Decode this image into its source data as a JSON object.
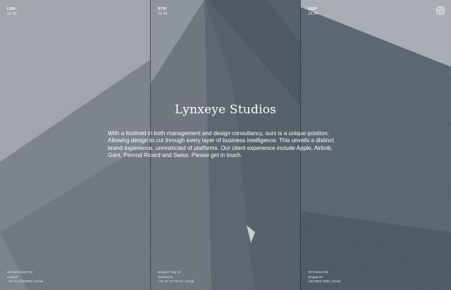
{
  "brand": {
    "title": "Lynxeye Studios"
  },
  "intro": {
    "text": "With a foothold in both management and design consultancy, ours is a unique position. Allowing design to cut through every layer of business intelligence. This unveils a distinct brand experience, unrestricted of platforms. Our client experience include Apple, Airbnb, Gant, Pernod Ricard and Swiss. Please get in touch."
  },
  "studios": [
    {
      "code": "LDN",
      "time": "10.34",
      "street": "20 Dorchester Rd",
      "city": "London",
      "phone": "+44 75 14834853",
      "email_label": "Email"
    },
    {
      "code": "STH",
      "time": "11.34",
      "street": "Bergdal Torg 16",
      "city": "Stockholm",
      "phone": "+46 75 747 80 71",
      "email_label": "Email"
    },
    {
      "code": "SGP",
      "time": "18.34",
      "street": "78 Duxton Rd",
      "city": "Singapore",
      "phone": "+65 8593 4086",
      "email_label": "Email"
    }
  ],
  "social": {
    "icon": "instagram-icon"
  },
  "colors": {
    "background": "#7f878f",
    "text": "#ffffff"
  }
}
